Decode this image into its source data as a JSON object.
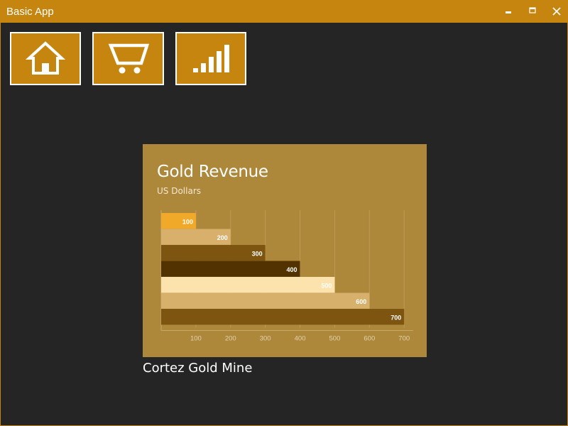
{
  "window": {
    "title": "Basic App",
    "controls": [
      "minimize-icon",
      "maximize-icon",
      "close-icon"
    ]
  },
  "nav": {
    "tiles": [
      {
        "icon": "home-icon",
        "label": ""
      },
      {
        "icon": "shopping-cart-icon",
        "label": ""
      },
      {
        "icon": "signal-bars-icon",
        "label": ""
      }
    ],
    "selected_index": 2
  },
  "tile_caption": "Cortez Gold Mine",
  "colors": {
    "accent": "#c6850f",
    "background": "#252525",
    "chart_bg": "#ad873a"
  },
  "chart_data": {
    "type": "bar",
    "orientation": "horizontal",
    "title": "Gold Revenue",
    "subtitle": "US Dollars",
    "xlabel": "",
    "ylabel": "",
    "categories": [
      "",
      "",
      "",
      "",
      "",
      "",
      ""
    ],
    "values": [
      100,
      200,
      300,
      400,
      500,
      600,
      700
    ],
    "data_labels": [
      "100",
      "200",
      "300",
      "400",
      "500",
      "600",
      "700"
    ],
    "bar_colors": [
      "#f1a92a",
      "#d8b06c",
      "#7d5410",
      "#523300",
      "#fce3ad",
      "#d7b06c",
      "#7d5410"
    ],
    "label_colors": [
      "#ffffff",
      "#ffffff",
      "#ffffff",
      "#ffffff",
      "#ffffff",
      "#ffffff",
      "#ffffff"
    ],
    "xlim": [
      0,
      720
    ],
    "x_ticks": [
      100,
      200,
      300,
      400,
      500,
      600,
      700
    ],
    "x_tick_labels": [
      "100",
      "200",
      "300",
      "400",
      "500",
      "600",
      "700"
    ],
    "grid": true,
    "legend": "none"
  }
}
